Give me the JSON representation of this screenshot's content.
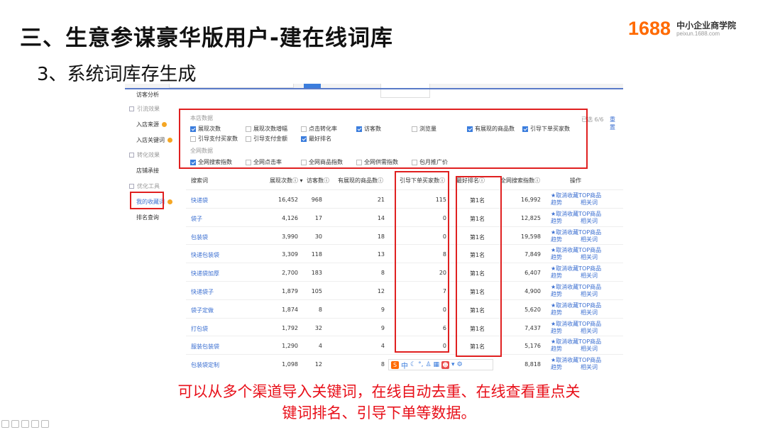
{
  "slide": {
    "title": "三、生意参谋豪华版用户-建在线词库",
    "subtitle": "3、系统词库存生成",
    "caption_line1": "可以从多个渠道导入关键词，在线自动去重、在线查看重点关",
    "caption_line2": "键词排名、引导下单等数据。"
  },
  "logo": {
    "number": "1688",
    "name": "中小企业商学院",
    "url": "peixun.1688.com",
    "brand_color": "#ff6a00"
  },
  "sidebar": {
    "top_item": "访客分析",
    "group_traffic": "引流效果",
    "item_entry_source": "入店来源",
    "item_entry_keyword": "入店关键词",
    "group_conversion": "转化效果",
    "item_shop_recommend": "店铺承接",
    "group_optimize": "优化工具",
    "item_my_collected": "我的收藏词",
    "item_rank_query": "排名查询"
  },
  "options": {
    "shop_label": "本店数据",
    "global_label": "全网数据",
    "count_text": "已选 6/6",
    "reset_text": "重置",
    "shop_items": [
      {
        "label": "展现次数",
        "checked": true
      },
      {
        "label": "展现次数增幅",
        "checked": false
      },
      {
        "label": "点击转化率",
        "checked": false
      },
      {
        "label": "访客数",
        "checked": true
      },
      {
        "label": "浏览量",
        "checked": false
      },
      {
        "label": "有展现的商品数",
        "checked": true
      },
      {
        "label": "引导下单买家数",
        "checked": true
      },
      {
        "label": "引导支付买家数",
        "checked": false
      },
      {
        "label": "引导支付金额",
        "checked": false
      },
      {
        "label": "最好排名",
        "checked": true
      }
    ],
    "global_items": [
      {
        "label": "全网搜索指数",
        "checked": true
      },
      {
        "label": "全网点击率",
        "checked": false
      },
      {
        "label": "全网商品指数",
        "checked": false
      },
      {
        "label": "全网供需指数",
        "checked": false
      },
      {
        "label": "包月推广价",
        "checked": false
      }
    ]
  },
  "table": {
    "headers": {
      "keyword": "搜索词",
      "impressions": "展现次数",
      "visitors": "访客数",
      "products": "有展现的商品数",
      "buyers": "引导下单买家数",
      "best_rank": "最好排名",
      "search_index": "全网搜索指数",
      "action": "操作"
    },
    "action_line1": "★取消收藏TOP商品",
    "action_line2a": "趋势",
    "action_line2b": "相关词",
    "rows": [
      {
        "keyword": "快递袋",
        "impressions": "16,452",
        "visitors": "968",
        "products": "21",
        "buyers": "115",
        "rank": "第1名",
        "index": "16,992"
      },
      {
        "keyword": "袋子",
        "impressions": "4,126",
        "visitors": "17",
        "products": "14",
        "buyers": "0",
        "rank": "第1名",
        "index": "12,825"
      },
      {
        "keyword": "包装袋",
        "impressions": "3,990",
        "visitors": "30",
        "products": "18",
        "buyers": "0",
        "rank": "第1名",
        "index": "19,598"
      },
      {
        "keyword": "快递包装袋",
        "impressions": "3,309",
        "visitors": "118",
        "products": "13",
        "buyers": "8",
        "rank": "第1名",
        "index": "7,849"
      },
      {
        "keyword": "快递袋加厚",
        "impressions": "2,700",
        "visitors": "183",
        "products": "8",
        "buyers": "20",
        "rank": "第1名",
        "index": "6,407"
      },
      {
        "keyword": "快递袋子",
        "impressions": "1,879",
        "visitors": "105",
        "products": "12",
        "buyers": "7",
        "rank": "第1名",
        "index": "4,900"
      },
      {
        "keyword": "袋子定做",
        "impressions": "1,874",
        "visitors": "8",
        "products": "9",
        "buyers": "0",
        "rank": "第1名",
        "index": "5,620"
      },
      {
        "keyword": "打包袋",
        "impressions": "1,792",
        "visitors": "32",
        "products": "9",
        "buyers": "6",
        "rank": "第1名",
        "index": "7,437"
      },
      {
        "keyword": "服装包装袋",
        "impressions": "1,290",
        "visitors": "4",
        "products": "4",
        "buyers": "0",
        "rank": "第1名",
        "index": "5,176"
      },
      {
        "keyword": "包装袋定制",
        "impressions": "1,098",
        "visitors": "12",
        "products": "8",
        "buyers": "",
        "rank": "",
        "index": "8,818"
      }
    ]
  },
  "float_bar": {
    "char": "中"
  },
  "colors": {
    "highlight_red": "#e02020",
    "link_blue": "#3b6fd1",
    "caption_red": "#e8101a"
  }
}
